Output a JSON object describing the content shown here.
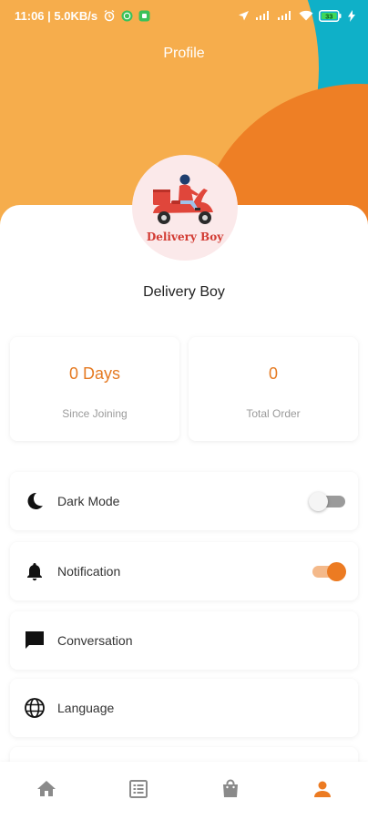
{
  "status_bar": {
    "time_info": "11:06 | 5.0KB/s",
    "battery": "33"
  },
  "header": {
    "title": "Profile"
  },
  "profile": {
    "avatar_text": "Delivery Boy",
    "name": "Delivery Boy"
  },
  "stats": [
    {
      "value": "0 Days",
      "label": "Since Joining"
    },
    {
      "value": "0",
      "label": "Total Order"
    }
  ],
  "menu": {
    "dark_mode": {
      "label": "Dark Mode",
      "enabled": false
    },
    "notification": {
      "label": "Notification",
      "enabled": true
    },
    "conversation": {
      "label": "Conversation"
    },
    "language": {
      "label": "Language"
    }
  },
  "bottom_nav": {
    "items": [
      "home-icon",
      "orders-list-icon",
      "shopping-bag-icon",
      "profile-icon"
    ],
    "active": "profile-icon"
  },
  "colors": {
    "accent": "#ec7b22",
    "teal": "#0fb0c8",
    "light_orange": "#f6ad4c",
    "dark_orange": "#ee7f25",
    "inactive_icon": "#8a8a8a"
  }
}
